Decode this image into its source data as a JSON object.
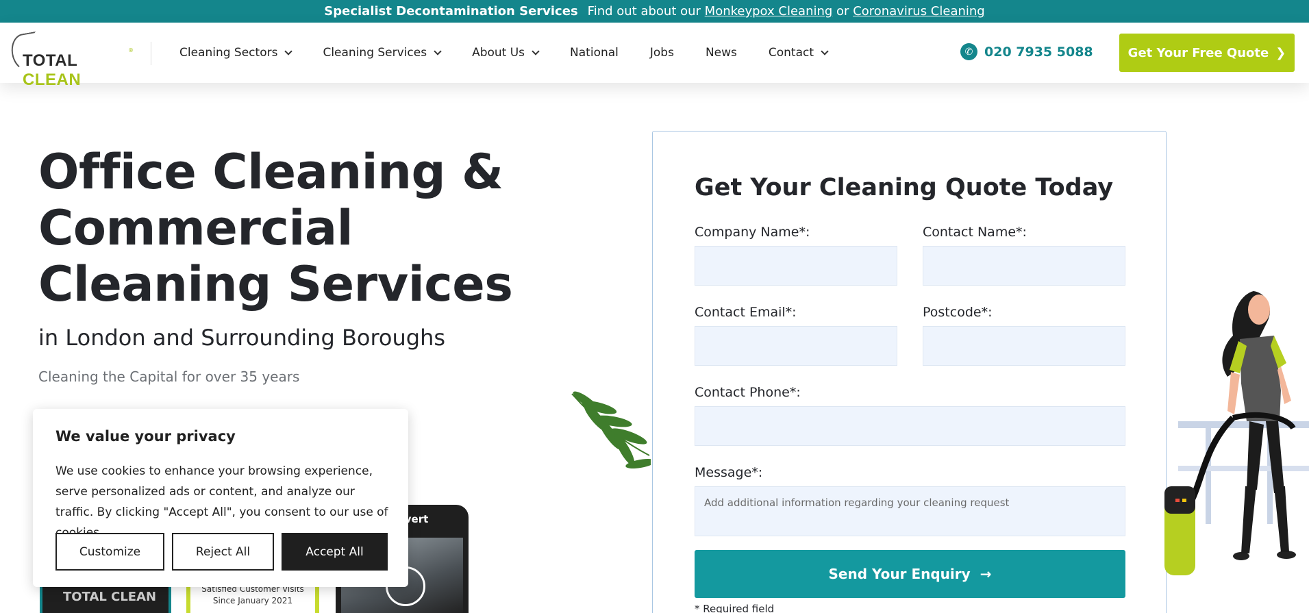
{
  "topbar": {
    "strong": "Specialist Decontamination Services",
    "lead": "Find out about our",
    "link1": "Monkeypox Cleaning",
    "or": "or",
    "link2": "Coronavirus Cleaning"
  },
  "header": {
    "logo_word1": "TOTAL",
    "logo_word2": "CLEAN",
    "logo_reg": "®",
    "nav": [
      {
        "label": "Cleaning Sectors",
        "dropdown": true
      },
      {
        "label": "Cleaning Services",
        "dropdown": true
      },
      {
        "label": "About Us",
        "dropdown": true
      },
      {
        "label": "National",
        "dropdown": false
      },
      {
        "label": "Jobs",
        "dropdown": false
      },
      {
        "label": "News",
        "dropdown": false
      },
      {
        "label": "Contact",
        "dropdown": true
      }
    ],
    "phone": "020 7935 5088",
    "quote_button": "Get Your Free Quote"
  },
  "hero": {
    "title": "Office Cleaning & Commercial Cleaning Services",
    "subtitle": "in London and Surrounding Boroughs",
    "tagline": "Cleaning the Capital for over 35 years"
  },
  "cards": {
    "card1_text": "TOTAL CLEAN",
    "card2_text": "Satisfied Customer Visits Since January 2021",
    "card3_caption": "dvert"
  },
  "cookie": {
    "title": "We value your privacy",
    "body": "We use cookies to enhance your browsing experience, serve personalized ads or content, and analyze our traffic. By clicking \"Accept All\", you consent to our use of cookies.",
    "customize": "Customize",
    "reject": "Reject All",
    "accept": "Accept All"
  },
  "form": {
    "title": "Get Your Cleaning Quote Today",
    "company_label": "Company Name*:",
    "contact_name_label": "Contact Name*:",
    "email_label": "Contact Email*:",
    "postcode_label": "Postcode*:",
    "phone_label": "Contact Phone*:",
    "message_label": "Message*:",
    "message_placeholder": "Add additional information regarding your cleaning request",
    "submit": "Send Your Enquiry",
    "required_note": "* Required field"
  },
  "colors": {
    "teal": "#14868c",
    "lime": "#afcc14",
    "field_bg": "#eef4fd"
  }
}
